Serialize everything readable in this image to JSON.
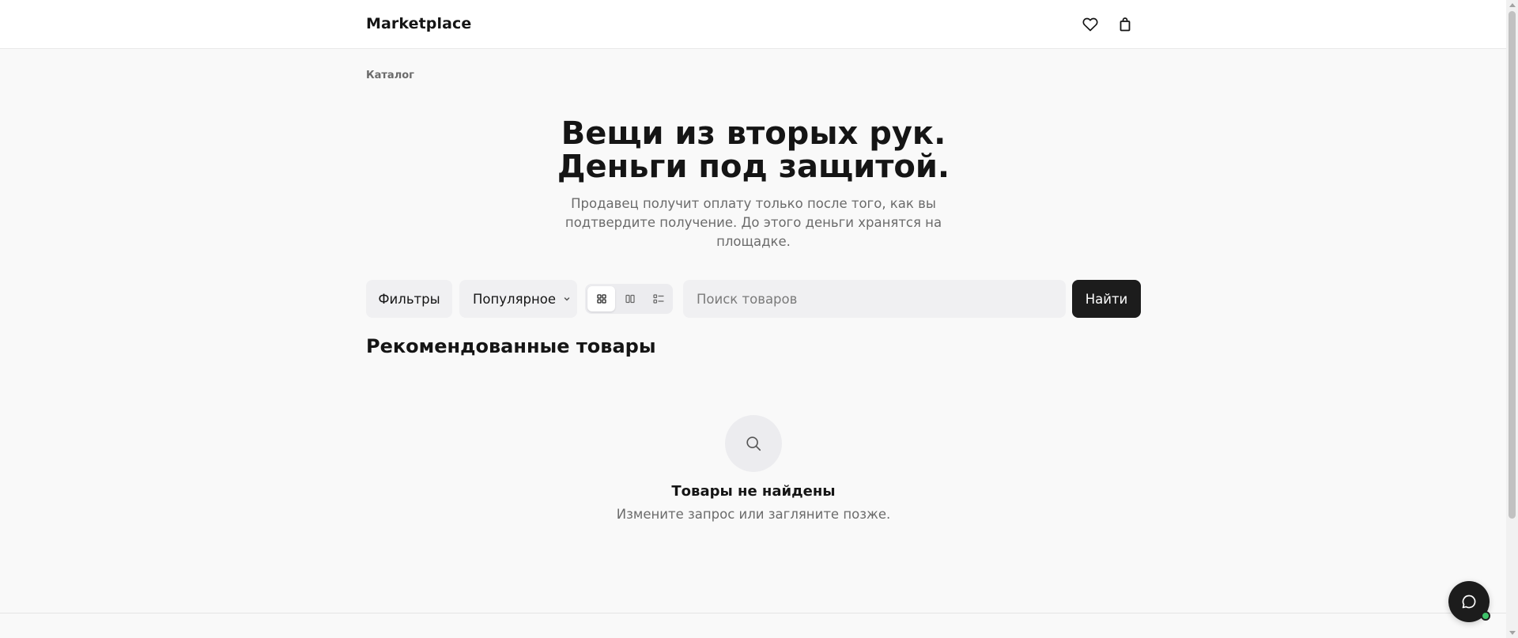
{
  "header": {
    "brand": "Marketplace",
    "icons": [
      "heart-icon",
      "shopping-bag-icon"
    ]
  },
  "breadcrumb": {
    "label": "Каталог"
  },
  "hero": {
    "title_line1": "Вещи из вторых рук.",
    "title_line2": "Деньги под защитой.",
    "subtitle": "Продавец получит оплату только после того, как вы подтвердите получение. До этого деньги хранятся на площадке."
  },
  "toolbar": {
    "filters_label": "Фильтры",
    "sort_label": "Популярное",
    "view_modes": [
      "grid-4-icon",
      "grid-2-icon",
      "list-icon"
    ],
    "active_view": "grid-4-icon",
    "search_placeholder": "Поиск товаров",
    "search_value": "",
    "find_label": "Найти"
  },
  "section": {
    "title": "Рекомендованные товары"
  },
  "empty_state": {
    "icon": "search-icon",
    "title": "Товары не найдены",
    "subtitle": "Измените запрос или загляните позже."
  },
  "chat": {
    "icon": "chat-bubble-icon",
    "status_color": "#3fc36a"
  },
  "colors": {
    "page_bg": "#f9f9f9",
    "primary_button": "#1c1c1c",
    "soft_button": "#f0f0f2",
    "muted_text": "#6b6b6b"
  }
}
